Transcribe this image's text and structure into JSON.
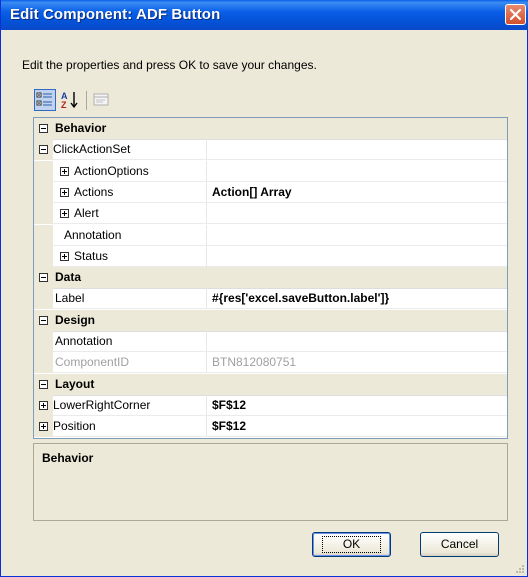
{
  "window": {
    "title": "Edit Component: ADF Button"
  },
  "instructions": "Edit the properties and press OK to save your changes.",
  "toolbar": {
    "buttons": [
      "categorized-icon",
      "alphabetical-icon",
      "property-pages-icon"
    ]
  },
  "grid": {
    "rows": [
      {
        "type": "category",
        "label": "Behavior"
      },
      {
        "type": "property",
        "label": "ClickActionSet",
        "value": "",
        "expander": "minus",
        "indent": 0
      },
      {
        "type": "property",
        "label": "ActionOptions",
        "value": "",
        "expander": "plus",
        "indent": 1
      },
      {
        "type": "property",
        "label": "Actions",
        "value": "Action[] Array",
        "expander": "plus",
        "indent": 1,
        "bold": true
      },
      {
        "type": "property",
        "label": "Alert",
        "value": "",
        "expander": "plus",
        "indent": 1
      },
      {
        "type": "property",
        "label": "Annotation",
        "value": "",
        "expander": "none",
        "indent": 1
      },
      {
        "type": "property",
        "label": "Status",
        "value": "",
        "expander": "plus",
        "indent": 1
      },
      {
        "type": "category",
        "label": "Data"
      },
      {
        "type": "property",
        "label": "Label",
        "value": "#{res['excel.saveButton.label']}",
        "expander": "none",
        "indent": 0,
        "bold": true
      },
      {
        "type": "category",
        "label": "Design"
      },
      {
        "type": "property",
        "label": "Annotation",
        "value": "",
        "expander": "none",
        "indent": 0
      },
      {
        "type": "property",
        "label": "ComponentID",
        "value": "BTN812080751",
        "expander": "none",
        "indent": 0,
        "disabled": true
      },
      {
        "type": "category",
        "label": "Layout"
      },
      {
        "type": "property",
        "label": "LowerRightCorner",
        "value": "$F$12",
        "expander": "plus",
        "indent": 0,
        "bold": true
      },
      {
        "type": "property",
        "label": "Position",
        "value": "$F$12",
        "expander": "plus",
        "indent": 0,
        "bold": true
      }
    ]
  },
  "description": {
    "title": "Behavior"
  },
  "buttons": {
    "ok": "OK",
    "cancel": "Cancel"
  }
}
